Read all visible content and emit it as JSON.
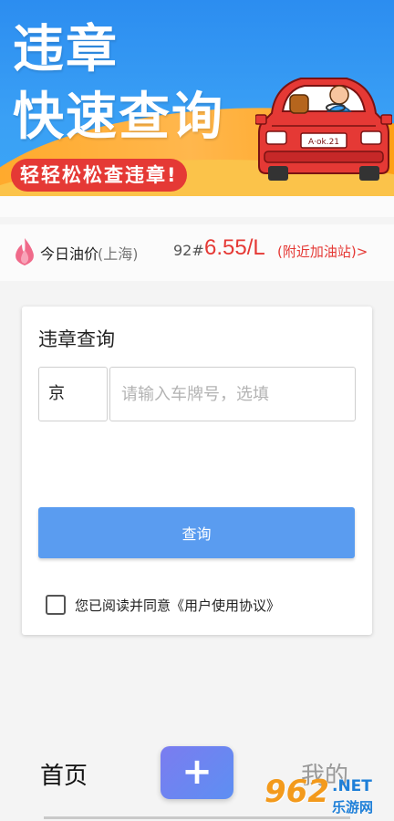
{
  "banner": {
    "title_line1": "违章",
    "title_line2": "快速查询",
    "tagline": "轻轻松松查违章!",
    "car_plate": "A·ok.21"
  },
  "oil": {
    "label": "今日油价",
    "city": "(上海)",
    "grade": "92#",
    "price": "6.55/L",
    "nearby_link": "(附近加油站)>"
  },
  "query_card": {
    "title": "违章查询",
    "province": "京",
    "plate_placeholder": "请输入车牌号，选填",
    "plate_value": "",
    "submit_label": "查询",
    "agreement_text": "您已阅读并同意《用户使用协议》",
    "agreement_checked": false
  },
  "nav": {
    "home_label": "首页",
    "add_icon": "plus-icon",
    "mine_label": "我的"
  },
  "watermark": {
    "number": "962",
    "net": ".NET",
    "site": "乐游网"
  },
  "colors": {
    "banner_blue": "#2c8df0",
    "banner_orange": "#ffa726",
    "accent_red": "#e53935",
    "button_blue": "#5a9cf0",
    "plus_gradient_start": "#7b7cf0"
  }
}
